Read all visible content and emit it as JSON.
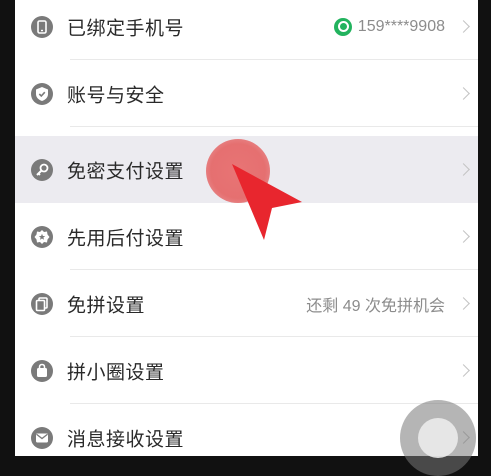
{
  "settings": {
    "rows": [
      {
        "label": "已绑定手机号",
        "value": "159****9908",
        "icon": "phone-icon"
      },
      {
        "label": "账号与安全",
        "value": "",
        "icon": "shield-check-icon"
      },
      {
        "label": "免密支付设置",
        "value": "",
        "icon": "key-icon"
      },
      {
        "label": "先用后付设置",
        "value": "",
        "icon": "badge-star-icon"
      },
      {
        "label": "免拼设置",
        "value": "还剩 49 次免拼机会",
        "icon": "copy-icon"
      },
      {
        "label": "拼小圈设置",
        "value": "",
        "icon": "bag-icon"
      },
      {
        "label": "消息接收设置",
        "value": "",
        "icon": "message-icon"
      }
    ]
  },
  "colors": {
    "icon_gray": "#7a7a7a",
    "verified_green": "#22b35e",
    "tap_red": "#e86e6e",
    "arrow_red": "#e8262e"
  }
}
